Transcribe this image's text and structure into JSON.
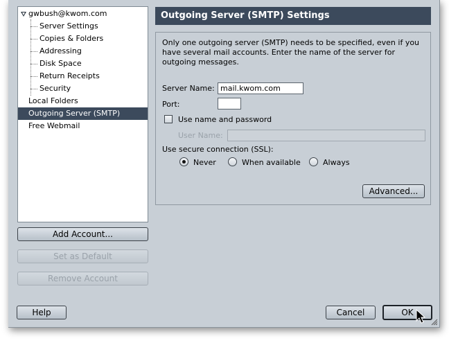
{
  "tree": {
    "account": "gwbush@kwom.com",
    "children": [
      "Server Settings",
      "Copies & Folders",
      "Addressing",
      "Disk Space",
      "Return Receipts",
      "Security"
    ],
    "local_folders": "Local Folders",
    "outgoing": "Outgoing Server (SMTP)",
    "webmail": "Free Webmail"
  },
  "left_buttons": {
    "add": "Add Account...",
    "set_default": "Set as Default",
    "remove": "Remove Account"
  },
  "panel": {
    "title": "Outgoing Server (SMTP) Settings",
    "description": "Only one outgoing server (SMTP) needs to be specified, even if you have several mail accounts. Enter the name of the server for outgoing messages.",
    "server_name_label": "Server Name:",
    "server_name_value": "mail.kwom.com",
    "port_label": "Port:",
    "port_value": "",
    "use_auth_label": "Use name and password",
    "use_auth_checked": false,
    "user_name_label": "User Name:",
    "user_name_value": "",
    "ssl_label": "Use secure connection (SSL):",
    "ssl_options": [
      "Never",
      "When available",
      "Always"
    ],
    "ssl_selected": "Never",
    "advanced": "Advanced..."
  },
  "footer": {
    "help": "Help",
    "cancel": "Cancel",
    "ok": "OK"
  }
}
